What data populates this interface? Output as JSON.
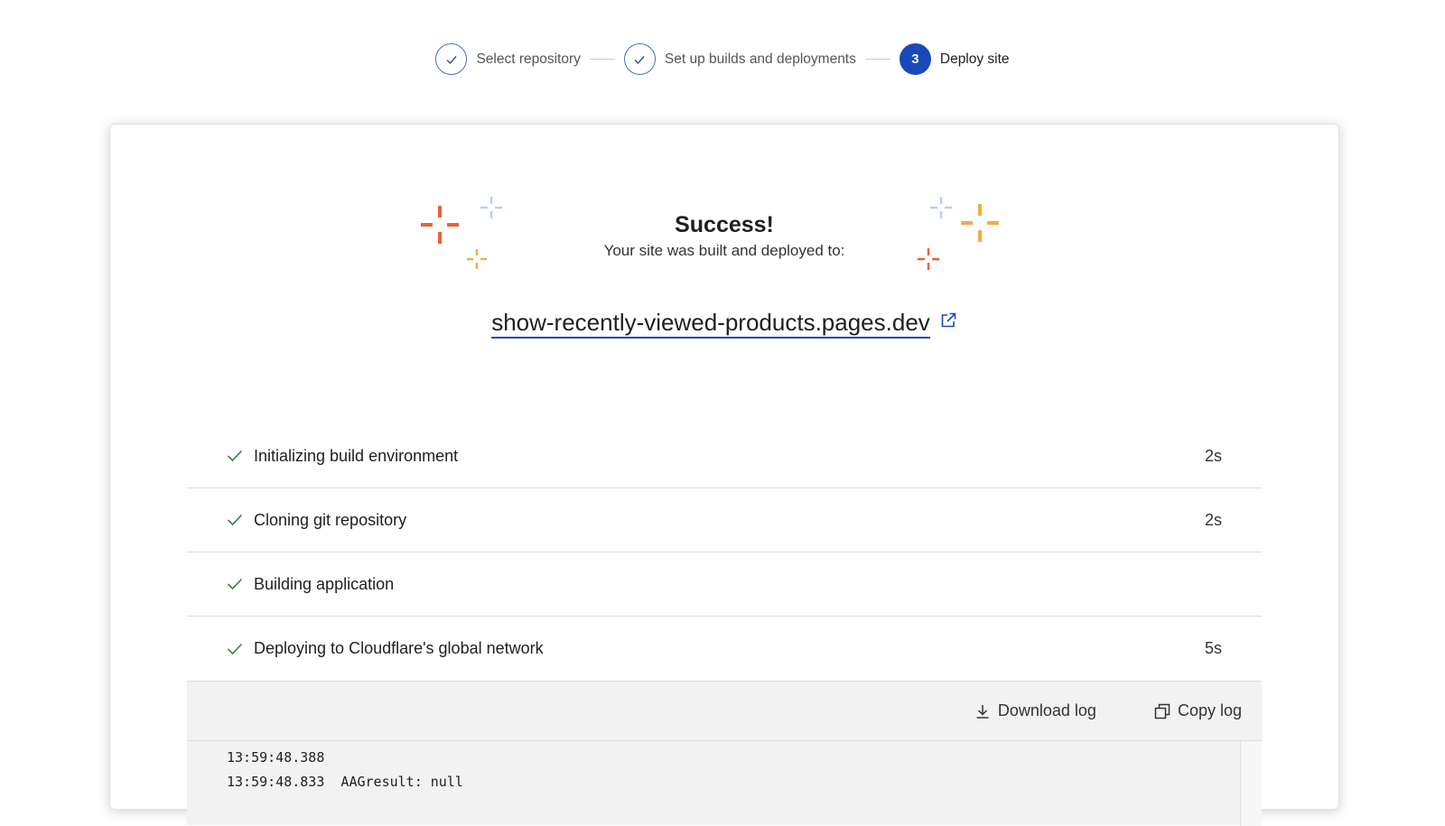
{
  "stepper": {
    "steps": [
      {
        "label": "Select repository",
        "state": "done"
      },
      {
        "label": "Set up builds and deployments",
        "state": "done"
      },
      {
        "number": "3",
        "label": "Deploy site",
        "state": "active"
      }
    ]
  },
  "result": {
    "title": "Success!",
    "subtitle": "Your site was built and deployed to:",
    "site_url": "show-recently-viewed-products.pages.dev"
  },
  "build_steps": [
    {
      "label": "Initializing build environment",
      "duration": "2s",
      "status": "success"
    },
    {
      "label": "Cloning git repository",
      "duration": "2s",
      "status": "success"
    },
    {
      "label": "Building application",
      "duration": "",
      "status": "success"
    },
    {
      "label": "Deploying to Cloudflare's global network",
      "duration": "5s",
      "status": "success"
    }
  ],
  "log": {
    "download_label": "Download log",
    "copy_label": "Copy log",
    "lines": [
      "13:59:48.388",
      "13:59:48.833  AAGresult: null"
    ]
  },
  "colors": {
    "accent": "#1a48b8",
    "success": "#2e8540",
    "sparkle_orange": "#e8623a",
    "sparkle_yellow": "#f0ac46",
    "sparkle_blue": "#b9cdf2"
  },
  "icons": {
    "step_done": "check-icon",
    "external_link": "external-link-icon",
    "download": "download-icon",
    "copy": "copy-icon",
    "sparkle": "sparkle-icon"
  }
}
